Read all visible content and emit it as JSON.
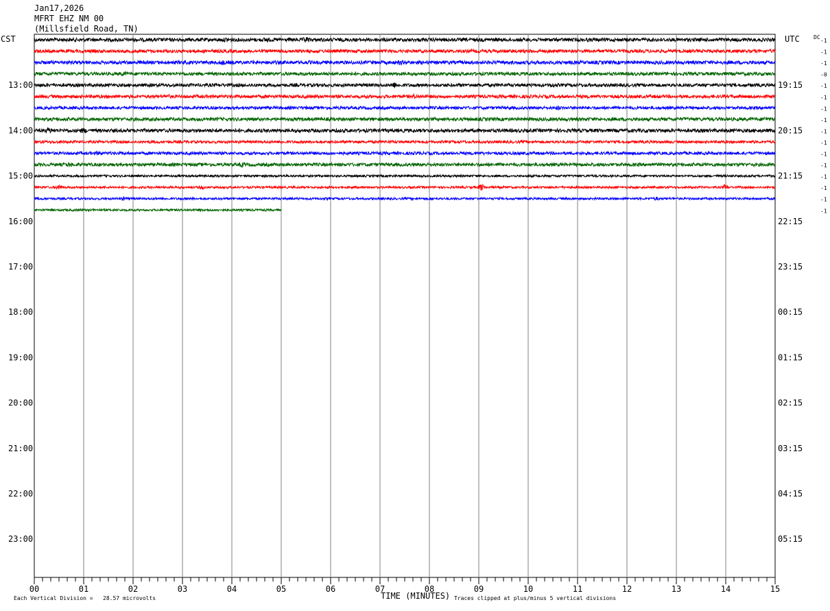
{
  "header": {
    "date": "Jan17,2026",
    "station": "MFRT EHZ NM 00",
    "location": "(Millsfield Road, TN)"
  },
  "chart_data": {
    "type": "line",
    "title": "",
    "xlabel": "TIME (MINUTES)",
    "left_axis_label": "CST",
    "right_axis_label": "UTC",
    "dc_label": "DC",
    "xlim": [
      0,
      15
    ],
    "x_ticks": [
      "00",
      "01",
      "02",
      "03",
      "04",
      "05",
      "06",
      "07",
      "08",
      "09",
      "10",
      "11",
      "12",
      "13",
      "14",
      "15"
    ],
    "grid": true,
    "rows_total": 44,
    "left_hour_labels": [
      "13:00",
      "14:00",
      "15:00",
      "16:00",
      "17:00",
      "18:00",
      "19:00",
      "20:00",
      "21:00",
      "22:00",
      "23:00"
    ],
    "right_hour_labels": [
      "19:15",
      "20:15",
      "21:15",
      "22:15",
      "23:15",
      "00:15",
      "01:15",
      "02:15",
      "03:15",
      "04:15",
      "05:15"
    ],
    "hour_label_first_row": 4,
    "hour_label_every_rows": 4,
    "series_colors": [
      "#000000",
      "#ff0000",
      "#0000ff",
      "#006400"
    ],
    "traces": [
      {
        "row": 0,
        "end_minute": 15,
        "dc": "-1",
        "amp": 2.6,
        "events": [
          {
            "t": 4.7,
            "amp": 2
          },
          {
            "t": 5.5,
            "amp": 2
          },
          {
            "t": 3.9,
            "amp": 1.5
          }
        ]
      },
      {
        "row": 1,
        "end_minute": 15,
        "dc": "-1",
        "amp": 2.4,
        "events": []
      },
      {
        "row": 2,
        "end_minute": 15,
        "dc": "-1",
        "amp": 2.6,
        "events": [
          {
            "t": 3.8,
            "amp": 1.6
          },
          {
            "t": 7.4,
            "amp": 1.4
          }
        ]
      },
      {
        "row": 3,
        "end_minute": 15,
        "dc": "-0",
        "amp": 2.4,
        "events": [
          {
            "t": 1.8,
            "amp": 1.4
          }
        ]
      },
      {
        "row": 4,
        "end_minute": 15,
        "dc": "-1",
        "amp": 2.4,
        "events": [
          {
            "t": 7.3,
            "amp": 2.2
          },
          {
            "t": 10.5,
            "amp": 1.4
          }
        ]
      },
      {
        "row": 5,
        "end_minute": 15,
        "dc": "-1",
        "amp": 2.4,
        "events": [
          {
            "t": 2.7,
            "amp": 1.2
          },
          {
            "t": 7.7,
            "amp": 1.3
          }
        ]
      },
      {
        "row": 6,
        "end_minute": 15,
        "dc": "-1",
        "amp": 2.2,
        "events": [
          {
            "t": 10.6,
            "amp": 1.3
          }
        ]
      },
      {
        "row": 7,
        "end_minute": 15,
        "dc": "-1",
        "amp": 2.5,
        "events": [
          {
            "t": 14.8,
            "amp": 1.4
          }
        ]
      },
      {
        "row": 8,
        "end_minute": 15,
        "dc": "-1",
        "amp": 2.6,
        "events": [
          {
            "t": 0.3,
            "amp": 2.2
          },
          {
            "t": 1.0,
            "amp": 1.6
          }
        ]
      },
      {
        "row": 9,
        "end_minute": 15,
        "dc": "-1",
        "amp": 2.0,
        "events": []
      },
      {
        "row": 10,
        "end_minute": 15,
        "dc": "-1",
        "amp": 2.2,
        "events": [
          {
            "t": 1.3,
            "amp": 1.4
          }
        ]
      },
      {
        "row": 11,
        "end_minute": 15,
        "dc": "-1",
        "amp": 2.4,
        "events": [
          {
            "t": 0.7,
            "amp": 1.3
          },
          {
            "t": 4.2,
            "amp": 1.6
          }
        ]
      },
      {
        "row": 12,
        "end_minute": 15,
        "dc": "-1",
        "amp": 1.6,
        "events": []
      },
      {
        "row": 13,
        "end_minute": 15,
        "dc": "-1",
        "amp": 1.6,
        "events": [
          {
            "t": 0.5,
            "amp": 3
          },
          {
            "t": 3.4,
            "amp": 1.4
          },
          {
            "t": 9.05,
            "amp": 4
          },
          {
            "t": 14.0,
            "amp": 3
          }
        ]
      },
      {
        "row": 14,
        "end_minute": 15,
        "dc": "-1",
        "amp": 1.6,
        "events": [
          {
            "t": 1.8,
            "amp": 1.4
          },
          {
            "t": 12.6,
            "amp": 1.2
          }
        ]
      },
      {
        "row": 15,
        "end_minute": 5,
        "dc": "-1",
        "amp": 1.6,
        "events": []
      }
    ]
  },
  "footer": {
    "vertical_division_note": "Each Vertical Division =   28.57 microvolts",
    "clip_note": "Traces clipped at plus/minus 5 vertical divisions"
  }
}
